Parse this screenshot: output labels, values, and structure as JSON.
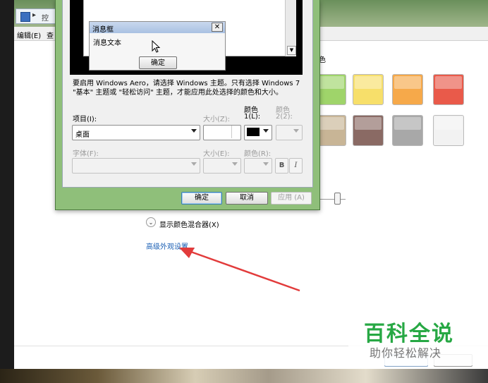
{
  "address_bar": {
    "text": "控",
    "arrow": "▸"
  },
  "menu": {
    "edit": "编辑(E)",
    "view": "查"
  },
  "dialog": {
    "preview": {
      "msgbox_title": "消息框",
      "msgbox_close": "✕",
      "msgbox_text": "消息文本",
      "msgbox_ok": "确定"
    },
    "hint": "要启用 Windows Aero，请选择 Windows 主题。只有选择 Windows 7 \"基本\" 主题或 \"轻松访问\" 主题，才能应用此处选择的颜色和大小。",
    "item_label": "项目(I):",
    "item_value": "桌面",
    "size_label": "大小(Z):",
    "color1_label_a": "颜色",
    "color1_label_b": "1(L):",
    "color2_label_a": "颜色",
    "color2_label_b": "2(2):",
    "font_label": "字体(F):",
    "font_size_label": "大小(E):",
    "font_color_label": "颜色(R):",
    "bold_label": "B",
    "italic_label": "I",
    "ok_button": "确定",
    "cancel_button": "取消",
    "apply_button": "应用 (A)",
    "color1_value": "#000000"
  },
  "swatches": [
    {
      "color": "#9fd46a"
    },
    {
      "color": "#f7df6a"
    },
    {
      "color": "#f6a94a"
    },
    {
      "color": "#e95a4a"
    },
    {
      "color": "#c8b596"
    },
    {
      "color": "#8a6a64"
    },
    {
      "color": "#a8a8a8"
    },
    {
      "color": "#f2f2f2"
    }
  ],
  "behind": {
    "color_label": "色",
    "mixer_label": "显示颜色混合器(X)",
    "mixer_icon": "⌄",
    "advanced_link": "高级外观设置..."
  },
  "watermark": {
    "title": "百科全说",
    "subtitle": "助你轻松解决"
  }
}
